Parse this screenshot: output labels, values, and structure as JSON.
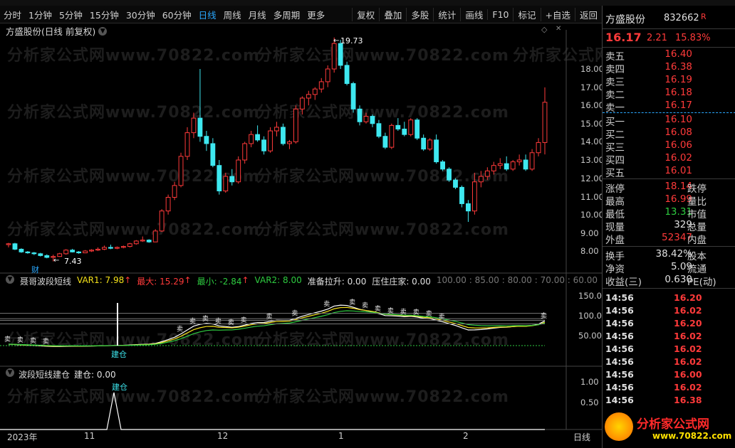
{
  "toolbar": {
    "timeframes": [
      "分时",
      "1分钟",
      "5分钟",
      "15分钟",
      "30分钟",
      "60分钟",
      "日线",
      "周线",
      "月线",
      "多周期",
      "更多"
    ],
    "active": "日线",
    "buttons": [
      "复权",
      "叠加",
      "多股",
      "统计",
      "画线",
      "F10",
      "标记",
      "+自选",
      "返回"
    ]
  },
  "chart": {
    "title": "方盛股份(日线 前复权)",
    "max_label": "19.73",
    "min_label": "7.43",
    "cai_label": "财",
    "y_labels": [
      "18.00",
      "17.00",
      "16.00",
      "15.00",
      "14.00",
      "13.00",
      "12.00",
      "11.00",
      "10.00",
      "9.00",
      "8.00"
    ],
    "x_labels": [
      "2023年",
      "11",
      "12",
      "1",
      "2"
    ],
    "x_right": "日线"
  },
  "ind1": {
    "name": "聂哥波段短线",
    "var1": "VAR1: 7.98",
    "max": "最大: 15.29",
    "min": "最小: -2.84",
    "var2": "VAR2: 8.00",
    "zbls": "准备拉升: 0.00",
    "yzzj": "压住庄家: 0.00",
    "gray": "100.00 : 85.00 : 80.00 : 70.00 : 60.00",
    "y_labels": [
      "150.0",
      "100.0",
      "50.00"
    ],
    "jiancang": "建仓",
    "sell": "卖"
  },
  "ind2": {
    "name": "波段短线建仓",
    "value": "建仓: 0.00",
    "y_labels": [
      "1.00",
      "0.50"
    ],
    "jiancang": "建仓"
  },
  "quote": {
    "name": "方盛股份",
    "code": "832662",
    "r": "R",
    "price": "16.17",
    "change": "2.21",
    "pct": "15.83%",
    "asks": [
      {
        "l": "卖五",
        "p": "16.40"
      },
      {
        "l": "卖四",
        "p": "16.38"
      },
      {
        "l": "卖三",
        "p": "16.19"
      },
      {
        "l": "卖二",
        "p": "16.18"
      },
      {
        "l": "卖一",
        "p": "16.17"
      }
    ],
    "bids": [
      {
        "l": "买一",
        "p": "16.10"
      },
      {
        "l": "买二",
        "p": "16.08"
      },
      {
        "l": "买三",
        "p": "16.06"
      },
      {
        "l": "买四",
        "p": "16.02"
      },
      {
        "l": "买五",
        "p": "16.01"
      }
    ],
    "stats": [
      {
        "l": "涨停",
        "v": "18.14",
        "r": "跌停",
        "c": "#ff3a3a"
      },
      {
        "l": "最高",
        "v": "16.99",
        "r": "量比",
        "c": "#ff3a3a"
      },
      {
        "l": "最低",
        "v": "13.31",
        "r": "市值",
        "c": "#2ecc40"
      },
      {
        "l": "现量",
        "v": "329",
        "r": "总量",
        "c": "#e0e0e0"
      },
      {
        "l": "外盘",
        "v": "52347",
        "r": "内盘",
        "c": "#ff3a3a"
      }
    ],
    "stats2": [
      {
        "l": "换手",
        "v": "38.42%",
        "r": "股本"
      },
      {
        "l": "净资",
        "v": "5.09",
        "r": "流通"
      },
      {
        "l": "收益(三)",
        "v": "0.630",
        "r": "PE(动)"
      }
    ],
    "ticks": [
      {
        "t": "14:56",
        "p": "16.20"
      },
      {
        "t": "14:56",
        "p": "16.02"
      },
      {
        "t": "14:56",
        "p": "16.20"
      },
      {
        "t": "14:56",
        "p": "16.02"
      },
      {
        "t": "14:56",
        "p": "16.02"
      },
      {
        "t": "14:56",
        "p": "16.02"
      },
      {
        "t": "14:56",
        "p": "16.00"
      },
      {
        "t": "14:56",
        "p": "16.02"
      },
      {
        "t": "14:56",
        "p": "16.38"
      }
    ]
  },
  "watermark": {
    "text": "分析家公式网www.70822.com",
    "logo_top": "分析家公式网",
    "logo_bottom": "www.70822.com"
  },
  "colors": {
    "up": "#ff3a3a",
    "down": "#3ee8f0",
    "ma_white": "#ffffff",
    "ma_yellow": "#f5e21a",
    "ma_green": "#2ecc40"
  },
  "chart_data": {
    "type": "candlestick",
    "candles": [
      [
        8.35,
        8.45,
        8.2,
        8.4
      ],
      [
        8.4,
        8.45,
        8.05,
        8.1
      ],
      [
        8.1,
        8.15,
        7.9,
        7.95
      ],
      [
        7.95,
        8.0,
        7.85,
        7.9
      ],
      [
        7.9,
        7.95,
        7.78,
        7.85
      ],
      [
        7.85,
        7.9,
        7.7,
        7.75
      ],
      [
        7.75,
        7.82,
        7.6,
        7.65
      ],
      [
        7.65,
        7.8,
        7.43,
        7.7
      ],
      [
        7.7,
        7.9,
        7.68,
        7.85
      ],
      [
        7.85,
        8.1,
        7.8,
        8.05
      ],
      [
        8.05,
        8.12,
        7.92,
        7.95
      ],
      [
        7.95,
        8.0,
        7.85,
        7.9
      ],
      [
        7.9,
        8.05,
        7.88,
        8.0
      ],
      [
        8.0,
        8.1,
        7.95,
        8.05
      ],
      [
        8.05,
        8.2,
        8.0,
        8.1
      ],
      [
        8.1,
        8.3,
        8.05,
        8.2
      ],
      [
        8.2,
        8.35,
        8.1,
        8.15
      ],
      [
        8.15,
        8.25,
        8.1,
        8.2
      ],
      [
        8.2,
        8.3,
        8.15,
        8.25
      ],
      [
        8.25,
        8.45,
        8.2,
        8.4
      ],
      [
        8.4,
        8.6,
        8.35,
        8.55
      ],
      [
        8.55,
        8.8,
        8.5,
        8.6
      ],
      [
        8.6,
        8.65,
        8.45,
        8.5
      ],
      [
        8.5,
        9.2,
        8.5,
        9.1
      ],
      [
        9.1,
        10.3,
        9.05,
        10.2
      ],
      [
        10.2,
        11.1,
        10.0,
        10.95
      ],
      [
        10.95,
        11.8,
        10.8,
        11.6
      ],
      [
        11.6,
        13.4,
        11.5,
        13.2
      ],
      [
        13.2,
        14.8,
        13.0,
        14.5
      ],
      [
        14.5,
        15.6,
        14.2,
        15.3
      ],
      [
        15.3,
        18.0,
        14.0,
        14.3
      ],
      [
        14.3,
        14.6,
        13.5,
        13.9
      ],
      [
        13.9,
        14.2,
        12.6,
        12.7
      ],
      [
        12.7,
        13.0,
        11.1,
        11.3
      ],
      [
        11.3,
        12.3,
        11.2,
        12.1
      ],
      [
        12.1,
        12.5,
        11.6,
        11.8
      ],
      [
        11.8,
        13.2,
        11.7,
        13.0
      ],
      [
        13.0,
        14.0,
        12.8,
        13.9
      ],
      [
        13.9,
        14.6,
        13.7,
        14.4
      ],
      [
        14.4,
        14.9,
        14.0,
        14.1
      ],
      [
        14.1,
        14.3,
        13.3,
        13.5
      ],
      [
        13.5,
        14.8,
        13.4,
        14.6
      ],
      [
        14.6,
        15.1,
        14.3,
        14.8
      ],
      [
        14.8,
        15.0,
        13.8,
        13.9
      ],
      [
        13.9,
        14.1,
        13.6,
        14.0
      ],
      [
        14.0,
        16.0,
        13.9,
        15.8
      ],
      [
        15.8,
        16.5,
        15.5,
        16.4
      ],
      [
        16.4,
        16.8,
        16.0,
        16.6
      ],
      [
        16.6,
        17.0,
        16.3,
        16.9
      ],
      [
        16.9,
        17.5,
        16.7,
        17.3
      ],
      [
        17.3,
        18.2,
        17.0,
        18.0
      ],
      [
        18.0,
        19.73,
        17.8,
        19.4
      ],
      [
        19.4,
        19.6,
        18.0,
        18.2
      ],
      [
        18.2,
        18.4,
        17.1,
        17.2
      ],
      [
        17.2,
        17.3,
        15.6,
        15.8
      ],
      [
        15.8,
        16.0,
        14.9,
        15.1
      ],
      [
        15.1,
        15.6,
        15.0,
        15.4
      ],
      [
        15.4,
        15.5,
        14.8,
        15.0
      ],
      [
        15.0,
        15.2,
        14.2,
        14.3
      ],
      [
        14.3,
        14.5,
        13.6,
        13.7
      ],
      [
        13.7,
        15.0,
        13.6,
        14.9
      ],
      [
        14.9,
        15.3,
        14.6,
        14.7
      ],
      [
        14.7,
        15.1,
        14.3,
        14.4
      ],
      [
        14.4,
        15.3,
        14.3,
        15.2
      ],
      [
        15.2,
        15.3,
        14.1,
        14.2
      ],
      [
        14.2,
        14.4,
        13.5,
        13.6
      ],
      [
        13.6,
        14.2,
        13.5,
        14.1
      ],
      [
        14.1,
        14.4,
        12.8,
        12.9
      ],
      [
        12.9,
        13.0,
        12.4,
        12.5
      ],
      [
        12.5,
        12.6,
        11.8,
        11.9
      ],
      [
        11.9,
        12.0,
        11.4,
        11.5
      ],
      [
        11.5,
        11.6,
        10.4,
        10.6
      ],
      [
        10.6,
        10.8,
        9.6,
        10.2
      ],
      [
        10.2,
        12.3,
        10.0,
        11.8
      ],
      [
        11.8,
        12.4,
        11.5,
        12.1
      ],
      [
        12.1,
        12.6,
        11.9,
        12.4
      ],
      [
        12.4,
        12.9,
        12.2,
        12.7
      ],
      [
        12.7,
        13.1,
        12.5,
        12.8
      ],
      [
        12.8,
        13.2,
        12.4,
        12.5
      ],
      [
        12.5,
        13.0,
        12.4,
        12.9
      ],
      [
        12.9,
        13.3,
        12.7,
        13.0
      ],
      [
        13.0,
        13.3,
        12.4,
        12.5
      ],
      [
        12.5,
        13.6,
        12.4,
        13.4
      ],
      [
        13.4,
        14.2,
        13.2,
        13.96
      ],
      [
        13.96,
        16.99,
        13.31,
        16.17
      ]
    ],
    "y_range": [
      7.0,
      20.0
    ]
  }
}
